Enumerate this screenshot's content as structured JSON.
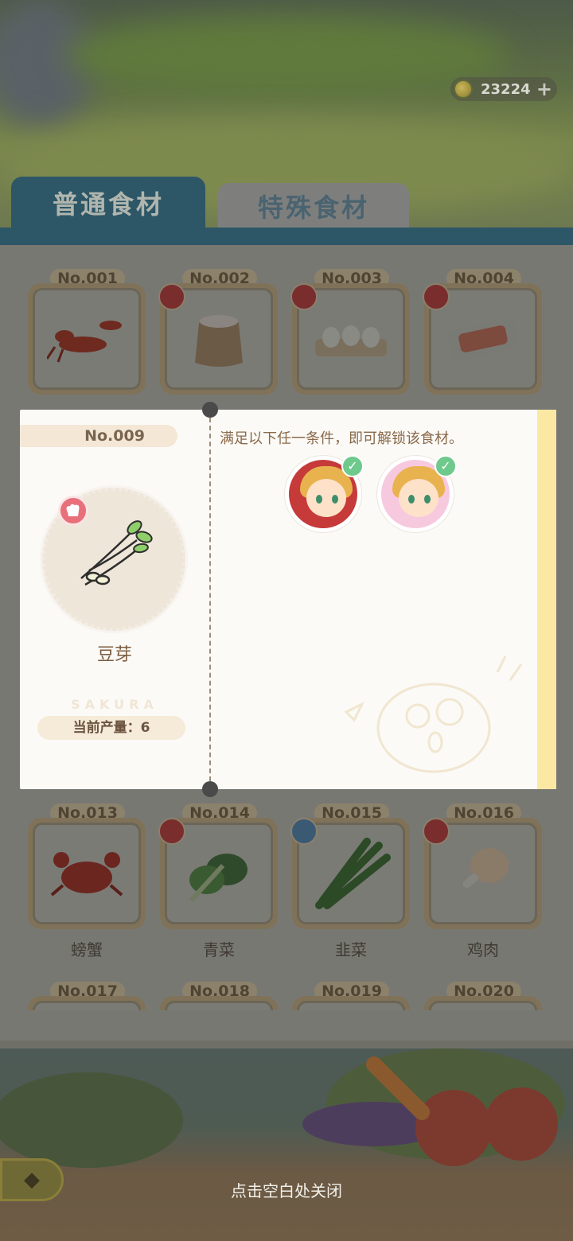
{
  "currency": {
    "amount": "23224",
    "plus": "+"
  },
  "tabs": [
    {
      "label": "普通食材",
      "active": true
    },
    {
      "label": "特殊食材",
      "active": false
    }
  ],
  "grid": {
    "row1": [
      {
        "no": "No.001",
        "name": ""
      },
      {
        "no": "No.002",
        "name": ""
      },
      {
        "no": "No.003",
        "name": ""
      },
      {
        "no": "No.004",
        "name": ""
      }
    ],
    "row4": [
      {
        "no": "No.013",
        "name": "螃蟹"
      },
      {
        "no": "No.014",
        "name": "青菜"
      },
      {
        "no": "No.015",
        "name": "韭菜"
      },
      {
        "no": "No.016",
        "name": "鸡肉"
      }
    ],
    "row5": [
      {
        "no": "No.017"
      },
      {
        "no": "No.018"
      },
      {
        "no": "No.019"
      },
      {
        "no": "No.020"
      }
    ]
  },
  "dialog": {
    "no": "No.009",
    "name": "豆芽",
    "brand": "SAKURA",
    "production": "当前产量：6",
    "unlock_text": "满足以下任一条件，即可解锁该食材。",
    "check": "✓"
  },
  "footer": {
    "close_hint": "点击空白处关闭",
    "back_icon": "◆"
  },
  "colors": {
    "accent": "#2d5667",
    "badge": "#e8707a",
    "check": "#6ec98c",
    "stripe": "#fbe8a3"
  }
}
